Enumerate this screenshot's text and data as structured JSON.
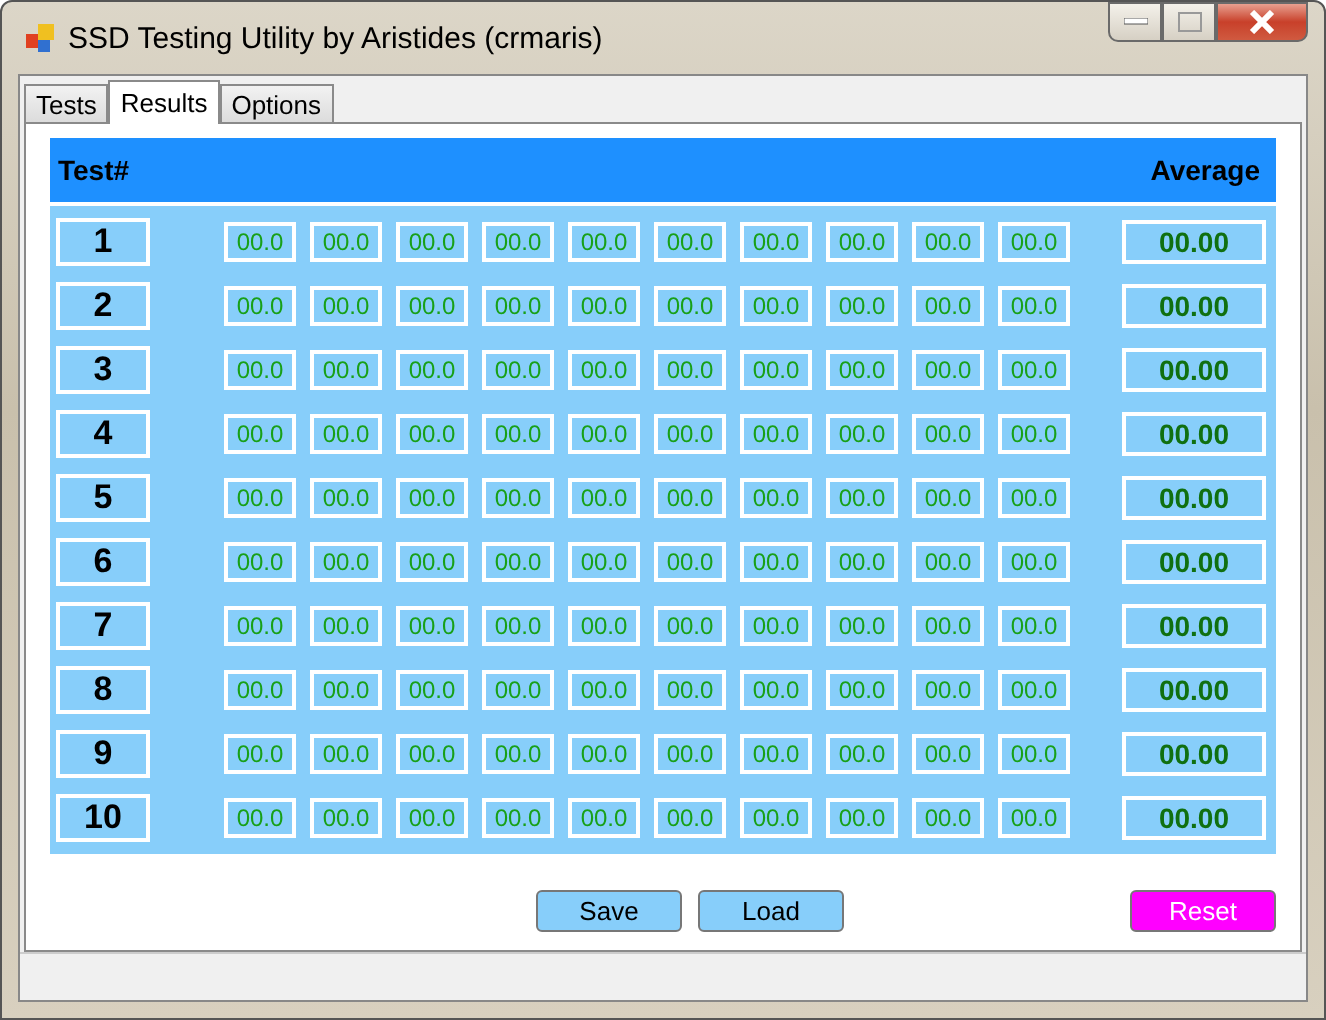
{
  "window": {
    "title": "SSD Testing Utility by Aristides (crmaris)"
  },
  "tabs": [
    {
      "label": "Tests",
      "selected": false
    },
    {
      "label": "Results",
      "selected": true
    },
    {
      "label": "Options",
      "selected": false
    }
  ],
  "table": {
    "columns": [
      "Test#",
      "Average"
    ],
    "rows": [
      {
        "test": "1",
        "values": [
          "00.0",
          "00.0",
          "00.0",
          "00.0",
          "00.0",
          "00.0",
          "00.0",
          "00.0",
          "00.0",
          "00.0"
        ],
        "average": "00.00"
      },
      {
        "test": "2",
        "values": [
          "00.0",
          "00.0",
          "00.0",
          "00.0",
          "00.0",
          "00.0",
          "00.0",
          "00.0",
          "00.0",
          "00.0"
        ],
        "average": "00.00"
      },
      {
        "test": "3",
        "values": [
          "00.0",
          "00.0",
          "00.0",
          "00.0",
          "00.0",
          "00.0",
          "00.0",
          "00.0",
          "00.0",
          "00.0"
        ],
        "average": "00.00"
      },
      {
        "test": "4",
        "values": [
          "00.0",
          "00.0",
          "00.0",
          "00.0",
          "00.0",
          "00.0",
          "00.0",
          "00.0",
          "00.0",
          "00.0"
        ],
        "average": "00.00"
      },
      {
        "test": "5",
        "values": [
          "00.0",
          "00.0",
          "00.0",
          "00.0",
          "00.0",
          "00.0",
          "00.0",
          "00.0",
          "00.0",
          "00.0"
        ],
        "average": "00.00"
      },
      {
        "test": "6",
        "values": [
          "00.0",
          "00.0",
          "00.0",
          "00.0",
          "00.0",
          "00.0",
          "00.0",
          "00.0",
          "00.0",
          "00.0"
        ],
        "average": "00.00"
      },
      {
        "test": "7",
        "values": [
          "00.0",
          "00.0",
          "00.0",
          "00.0",
          "00.0",
          "00.0",
          "00.0",
          "00.0",
          "00.0",
          "00.0"
        ],
        "average": "00.00"
      },
      {
        "test": "8",
        "values": [
          "00.0",
          "00.0",
          "00.0",
          "00.0",
          "00.0",
          "00.0",
          "00.0",
          "00.0",
          "00.0",
          "00.0"
        ],
        "average": "00.00"
      },
      {
        "test": "9",
        "values": [
          "00.0",
          "00.0",
          "00.0",
          "00.0",
          "00.0",
          "00.0",
          "00.0",
          "00.0",
          "00.0",
          "00.0"
        ],
        "average": "00.00"
      },
      {
        "test": "10",
        "values": [
          "00.0",
          "00.0",
          "00.0",
          "00.0",
          "00.0",
          "00.0",
          "00.0",
          "00.0",
          "00.0",
          "00.0"
        ],
        "average": "00.00"
      }
    ]
  },
  "buttons": [
    {
      "label": "Save",
      "kind": "normal"
    },
    {
      "label": "Load",
      "kind": "normal"
    },
    {
      "label": "Reset",
      "kind": "danger"
    }
  ]
}
